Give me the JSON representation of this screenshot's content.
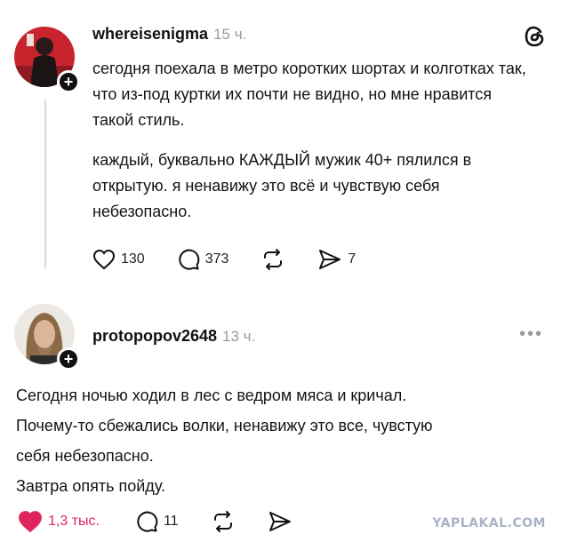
{
  "post1": {
    "username": "whereisenigma",
    "time": "15 ч.",
    "paragraph1": "сегодня поехала в метро коротких шортах и колготках так, что из-под куртки их почти не видно, но мне нравится такой стиль.",
    "paragraph2": "каждый, буквально КАЖДЫЙ мужик 40+ пялился в открытую. я ненавижу это всё и чувствую себя небезопасно.",
    "likes": "130",
    "comments": "373",
    "shares": "7"
  },
  "post2": {
    "username": "protopopov2648",
    "time": "13 ч.",
    "line1": "Сегодня ночью ходил в лес с ведром мяса и кричал.",
    "line2": "Почему-то сбежались волки, ненавижу это все, чувстую",
    "line3": "себя небезопасно.",
    "line4": "Завтра опять пойду.",
    "likes": "1,3 тыс.",
    "comments": "11"
  },
  "watermark": "YAPLAKAL.COM",
  "colors": {
    "like_active": "#e0245e",
    "muted": "#9a9a9a"
  },
  "icons": [
    "threads-logo-icon",
    "plus-icon",
    "heart-icon",
    "comment-icon",
    "repost-icon",
    "share-icon",
    "more-icon"
  ]
}
